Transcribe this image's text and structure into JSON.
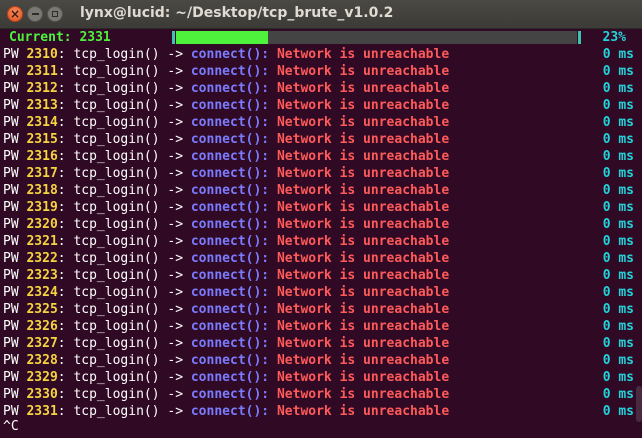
{
  "window": {
    "title": "lynx@lucid: ~/Desktop/tcp_brute_v1.0.2"
  },
  "status": {
    "label": "Current: 2331",
    "percent": "23%",
    "progress": 0.23
  },
  "log": {
    "prefix": "PW",
    "call": "tcp_login() -> ",
    "connect": "connect():",
    "error": "Network is unreachable",
    "duration": "0 ms",
    "entries": [
      "2310",
      "2311",
      "2312",
      "2313",
      "2314",
      "2315",
      "2316",
      "2317",
      "2318",
      "2319",
      "2320",
      "2321",
      "2322",
      "2323",
      "2324",
      "2325",
      "2326",
      "2327",
      "2328",
      "2329",
      "2330",
      "2331"
    ]
  },
  "prompt": {
    "interrupt": "^C"
  },
  "colors": {
    "background": "#300a24",
    "progress": "#4ef23d",
    "number": "#f5d442",
    "connect": "#7b7bff",
    "error": "#ff5a5a",
    "duration": "#22d3dc"
  }
}
